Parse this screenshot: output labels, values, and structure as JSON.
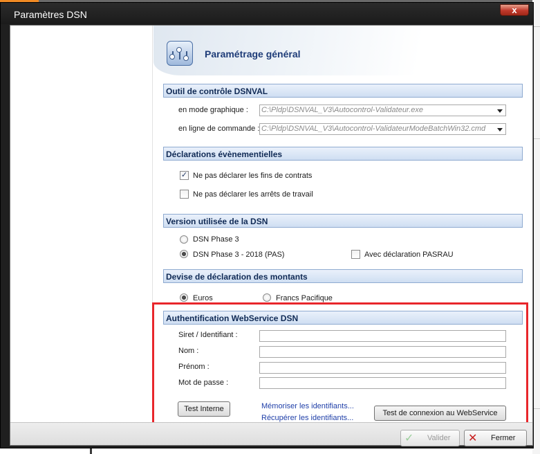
{
  "window": {
    "title": "Paramètres DSN",
    "close_glyph": "x"
  },
  "header": {
    "title": "Paramétrage général",
    "icon": "settings-sliders-icon"
  },
  "sections": {
    "dsnval": {
      "title": "Outil de contrôle DSNVAL",
      "graphical_label": "en mode graphique :",
      "graphical_value": "C:\\Pldp\\DSNVAL_V3\\Autocontrol-Validateur.exe",
      "cmd_label": "en ligne de commande :",
      "cmd_value": "C:\\Pldp\\DSNVAL_V3\\Autocontrol-ValidateurModeBatchWin32.cmd"
    },
    "events": {
      "title": "Déclarations évènementielles",
      "opt1_label": "Ne pas déclarer les fins de contrats",
      "opt1_checked": true,
      "opt2_label": "Ne pas déclarer les arrêts de travail",
      "opt2_checked": false
    },
    "version": {
      "title": "Version utilisée de la DSN",
      "phase3_label": "DSN Phase 3",
      "phase3_2018_label": "DSN Phase 3 - 2018 (PAS)",
      "selected": "phase3_2018",
      "pasrau_label": "Avec déclaration PASRAU",
      "pasrau_checked": false
    },
    "currency": {
      "title": "Devise de déclaration des montants",
      "euros_label": "Euros",
      "francs_label": "Francs Pacifique",
      "selected": "euros"
    },
    "auth": {
      "title": "Authentification WebService DSN",
      "siret_label": "Siret / Identifiant :",
      "siret_value": "",
      "nom_label": "Nom :",
      "nom_value": "",
      "prenom_label": "Prénom :",
      "prenom_value": "",
      "password_label": "Mot de passe :",
      "password_value": "",
      "test_internal_label": "Test Interne",
      "memorize_link": "Mémoriser les identifiants...",
      "retrieve_link": "Récupérer les identifiants...",
      "test_connection_label": "Test de connexion au WebService"
    }
  },
  "footer": {
    "validate_label": "Valider",
    "validate_enabled": false,
    "close_label": "Fermer"
  },
  "colors": {
    "section_text": "#102a55",
    "header_title": "#1e3c78",
    "link": "#1f3fa8",
    "highlight": "#e8262b"
  }
}
